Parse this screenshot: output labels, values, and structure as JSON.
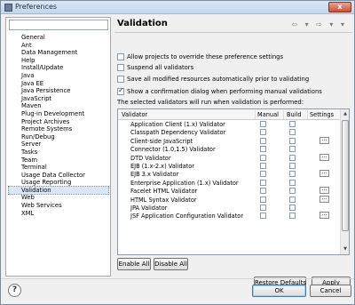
{
  "window": {
    "title": "Preferences",
    "close_label": "x"
  },
  "filter": {
    "value": "",
    "placeholder": ""
  },
  "nav": {
    "items": [
      "General",
      "Ant",
      "Data Management",
      "Help",
      "Install/Update",
      "Java",
      "Java EE",
      "Java Persistence",
      "JavaScript",
      "Maven",
      "Plug-in Development",
      "Project Archives",
      "Remote Systems",
      "Run/Debug",
      "Server",
      "Tasks",
      "Team",
      "Terminal",
      "Usage Data Collector",
      "Usage Reporting",
      "Validation",
      "Web",
      "Web Services",
      "XML"
    ],
    "selected": "Validation"
  },
  "page": {
    "title": "Validation",
    "nav_arrows": "⇦ ▾ ⇨ ▾ ▾",
    "options": [
      {
        "label": "Allow projects to override these preference settings",
        "checked": false
      },
      {
        "label": "Suspend all validators",
        "checked": false
      },
      {
        "label": "Save all modified resources automatically prior to validating",
        "checked": false
      },
      {
        "label": "Show a confirmation dialog when performing manual validations",
        "checked": true
      }
    ],
    "table_caption": "The selected validators will run when validation is performed:"
  },
  "table": {
    "headers": {
      "validator": "Validator",
      "manual": "Manual",
      "build": "Build",
      "settings": "Settings"
    },
    "settings_label": "...",
    "rows": [
      {
        "name": "Application Client (1.x) Validator",
        "manual": false,
        "build": false,
        "settings": false
      },
      {
        "name": "Classpath Dependency Validator",
        "manual": false,
        "build": false,
        "settings": false
      },
      {
        "name": "Client-side JavaScript",
        "manual": false,
        "build": false,
        "settings": true
      },
      {
        "name": "Connector (1.0,1.5) Validator",
        "manual": false,
        "build": false,
        "settings": false
      },
      {
        "name": "DTD Validator",
        "manual": false,
        "build": false,
        "settings": true
      },
      {
        "name": "EJB (1.x-2.x) Validator",
        "manual": false,
        "build": false,
        "settings": false
      },
      {
        "name": "EJB 3.x Validator",
        "manual": false,
        "build": false,
        "settings": true
      },
      {
        "name": "Enterprise Application (1.x) Validator",
        "manual": false,
        "build": false,
        "settings": false
      },
      {
        "name": "Facelet HTML Validator",
        "manual": false,
        "build": false,
        "settings": true
      },
      {
        "name": "HTML Syntax Validator",
        "manual": false,
        "build": false,
        "settings": true
      },
      {
        "name": "JPA Validator",
        "manual": false,
        "build": false,
        "settings": false
      },
      {
        "name": "JSF Application Configuration Validator",
        "manual": false,
        "build": false,
        "settings": true
      }
    ]
  },
  "buttons": {
    "enable_all": "Enable All",
    "disable_all": "Disable All",
    "restore_defaults": "Restore Defaults",
    "apply": "Apply",
    "ok": "OK",
    "cancel": "Cancel",
    "help": "?"
  }
}
